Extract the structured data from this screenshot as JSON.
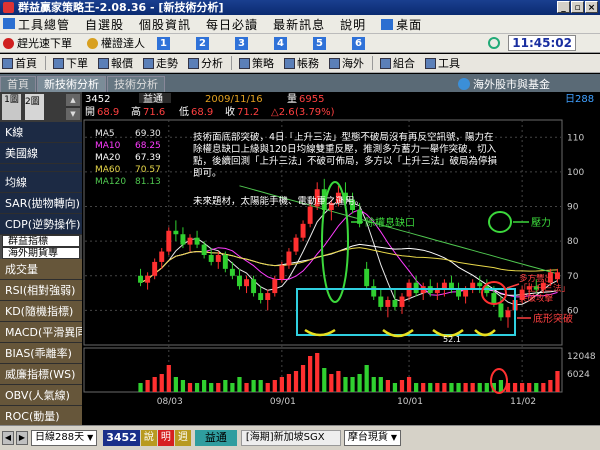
{
  "window": {
    "title": "群益贏家策略王-2.08.36 - [新技術分析]",
    "controls": [
      "_",
      "▫",
      "×"
    ]
  },
  "menu": [
    "工具總管",
    "自選股",
    "個股資訊",
    "每日必讀",
    "最新訊息",
    "說明",
    "桌面"
  ],
  "quickbar": {
    "items": [
      "趕光速下單",
      "權證達人"
    ],
    "numbers": [
      "1",
      "2",
      "3",
      "4",
      "5",
      "6"
    ],
    "clock": "11:45:02"
  },
  "toolbar": [
    "首頁",
    "下單",
    "報價",
    "走勢",
    "分析",
    "策略",
    "帳務",
    "海外",
    "組合",
    "工具"
  ],
  "tabs": [
    "首頁",
    "新技術分析",
    "技術分析"
  ],
  "overseas_label": "海外股市與基金",
  "left_panel": {
    "buttons": [
      "1圖",
      "2圖"
    ],
    "items": [
      "K線",
      "美國線",
      "",
      "均線",
      "SAR(拋物轉向)",
      "CDP(逆勢操作)",
      "群益指標",
      "海外期貨專",
      "成交量",
      "RSI(相對強弱)",
      "KD(隨機指標)",
      "MACD(平滑異同)",
      "BIAS(乖離率)",
      "威廉指標(WS)",
      "OBV(人氣線)",
      "ROC(動量)"
    ]
  },
  "stock_header": {
    "code": "3452",
    "name": "益通",
    "date": "2009/11/16",
    "volume_label": "量",
    "volume": "6955",
    "open_label": "開",
    "open": "68.9",
    "high_label": "高",
    "high": "71.6",
    "low_label": "低",
    "low": "68.9",
    "close_label": "收",
    "close": "71.2",
    "change": "△2.6",
    "change_pct": "(3.79%)",
    "period": "日288"
  },
  "ma_legend": [
    {
      "label": "MA5",
      "value": "69.30",
      "color": "#e8e8e8"
    },
    {
      "label": "MA10",
      "value": "68.25",
      "color": "#ff3cff"
    },
    {
      "label": "MA20",
      "value": "67.39",
      "color": "#ffffff"
    },
    {
      "label": "MA60",
      "value": "70.57",
      "color": "#e8d84a"
    },
    {
      "label": "MA120",
      "value": "81.13",
      "color": "#50c850"
    }
  ],
  "annotation": {
    "main_text": "技術面底部突破，4日「上升三法」型態不破局沒有再反空訊號，陽力在除權息缺口上緣與120日均線雙重反壓，推測多方蓄力一舉作突破，切入點，後續回測「上升三法」不破可佈局，多方以「上升三法」破局為停損即可。",
    "sub_text": "未來題材，太陽能手機、電動車之運用。",
    "label_gap": "除權息缺口",
    "label_pressure": "壓力",
    "label_rising": "多方豐出「上升三法」突破攻擊",
    "label_bottom": "底形突破"
  },
  "y_axis_price": [
    "110",
    "100",
    "90",
    "80",
    "70",
    "60"
  ],
  "y_axis_volume": [
    "12048",
    "6024"
  ],
  "x_axis": [
    "08/03",
    "09/01",
    "10/01",
    "11/02"
  ],
  "low_marker": "52.1",
  "bottom": {
    "range_label": "日線288天",
    "code": "3452",
    "buttons": [
      "說",
      "明",
      "週"
    ],
    "name": "益通",
    "ticker": "[海期]新加坡SGX",
    "market": "摩台現貨"
  },
  "chart_data": {
    "type": "candlestick",
    "x_ticks": [
      "08/03",
      "09/01",
      "10/01",
      "11/02"
    ],
    "price_ticks": [
      110,
      100,
      90,
      80,
      70,
      60
    ],
    "volume_ticks": [
      12048,
      6024
    ],
    "low_marker": 52.1,
    "candles": [
      {
        "o": 70,
        "h": 72,
        "l": 67,
        "c": 68
      },
      {
        "o": 68,
        "h": 71,
        "l": 66,
        "c": 70
      },
      {
        "o": 70,
        "h": 75,
        "l": 69,
        "c": 74
      },
      {
        "o": 74,
        "h": 78,
        "l": 72,
        "c": 77
      },
      {
        "o": 77,
        "h": 84,
        "l": 76,
        "c": 83
      },
      {
        "o": 83,
        "h": 86,
        "l": 80,
        "c": 82
      },
      {
        "o": 82,
        "h": 84,
        "l": 78,
        "c": 79
      },
      {
        "o": 79,
        "h": 82,
        "l": 77,
        "c": 81
      },
      {
        "o": 81,
        "h": 83,
        "l": 78,
        "c": 79
      },
      {
        "o": 79,
        "h": 80,
        "l": 75,
        "c": 76
      },
      {
        "o": 76,
        "h": 78,
        "l": 73,
        "c": 74
      },
      {
        "o": 74,
        "h": 77,
        "l": 72,
        "c": 76
      },
      {
        "o": 76,
        "h": 77,
        "l": 71,
        "c": 72
      },
      {
        "o": 72,
        "h": 74,
        "l": 69,
        "c": 70
      },
      {
        "o": 70,
        "h": 72,
        "l": 66,
        "c": 67
      },
      {
        "o": 67,
        "h": 70,
        "l": 65,
        "c": 69
      },
      {
        "o": 69,
        "h": 70,
        "l": 64,
        "c": 65
      },
      {
        "o": 65,
        "h": 67,
        "l": 62,
        "c": 63
      },
      {
        "o": 63,
        "h": 66,
        "l": 60,
        "c": 65
      },
      {
        "o": 65,
        "h": 70,
        "l": 64,
        "c": 69
      },
      {
        "o": 69,
        "h": 74,
        "l": 68,
        "c": 73
      },
      {
        "o": 73,
        "h": 78,
        "l": 72,
        "c": 77
      },
      {
        "o": 77,
        "h": 82,
        "l": 76,
        "c": 81
      },
      {
        "o": 81,
        "h": 86,
        "l": 80,
        "c": 85
      },
      {
        "o": 85,
        "h": 92,
        "l": 84,
        "c": 90
      },
      {
        "o": 90,
        "h": 97,
        "l": 89,
        "c": 95
      },
      {
        "o": 95,
        "h": 98,
        "l": 88,
        "c": 89
      },
      {
        "o": 89,
        "h": 92,
        "l": 86,
        "c": 91
      },
      {
        "o": 91,
        "h": 96,
        "l": 90,
        "c": 94
      },
      {
        "o": 94,
        "h": 97,
        "l": 91,
        "c": 92
      },
      {
        "o": 92,
        "h": 94,
        "l": 88,
        "c": 89
      },
      {
        "o": 89,
        "h": 91,
        "l": 84,
        "c": 85
      },
      {
        "o": 72,
        "h": 74,
        "l": 66,
        "c": 67
      },
      {
        "o": 67,
        "h": 69,
        "l": 63,
        "c": 64
      },
      {
        "o": 64,
        "h": 66,
        "l": 60,
        "c": 61
      },
      {
        "o": 61,
        "h": 64,
        "l": 58,
        "c": 63
      },
      {
        "o": 63,
        "h": 66,
        "l": 60,
        "c": 61
      },
      {
        "o": 61,
        "h": 65,
        "l": 59,
        "c": 64
      },
      {
        "o": 64,
        "h": 69,
        "l": 63,
        "c": 68
      },
      {
        "o": 68,
        "h": 70,
        "l": 64,
        "c": 65
      },
      {
        "o": 65,
        "h": 68,
        "l": 63,
        "c": 67
      },
      {
        "o": 67,
        "h": 69,
        "l": 64,
        "c": 65
      },
      {
        "o": 65,
        "h": 68,
        "l": 63,
        "c": 66
      },
      {
        "o": 66,
        "h": 69,
        "l": 64,
        "c": 68
      },
      {
        "o": 68,
        "h": 70,
        "l": 65,
        "c": 66
      },
      {
        "o": 66,
        "h": 68,
        "l": 63,
        "c": 64
      },
      {
        "o": 64,
        "h": 67,
        "l": 62,
        "c": 66
      },
      {
        "o": 66,
        "h": 69,
        "l": 65,
        "c": 68
      },
      {
        "o": 68,
        "h": 70,
        "l": 65,
        "c": 67
      },
      {
        "o": 67,
        "h": 69,
        "l": 64,
        "c": 65
      },
      {
        "o": 65,
        "h": 67,
        "l": 61,
        "c": 62
      },
      {
        "o": 62,
        "h": 64,
        "l": 57,
        "c": 58
      },
      {
        "o": 58,
        "h": 61,
        "l": 55,
        "c": 60
      },
      {
        "o": 60,
        "h": 64,
        "l": 59,
        "c": 63
      },
      {
        "o": 63,
        "h": 67,
        "l": 62,
        "c": 66
      },
      {
        "o": 66,
        "h": 68,
        "l": 64,
        "c": 67
      },
      {
        "o": 67,
        "h": 69,
        "l": 65,
        "c": 66
      },
      {
        "o": 66,
        "h": 69,
        "l": 65,
        "c": 68
      },
      {
        "o": 68,
        "h": 72,
        "l": 67,
        "c": 71
      },
      {
        "o": 69,
        "h": 72,
        "l": 68,
        "c": 71
      }
    ],
    "volumes": [
      3,
      4,
      5,
      6,
      9,
      5,
      4,
      3,
      3,
      4,
      3,
      3,
      4,
      3,
      5,
      3,
      4,
      4,
      3,
      4,
      5,
      6,
      7,
      9,
      12,
      13,
      8,
      6,
      7,
      5,
      5,
      6,
      9,
      5,
      5,
      4,
      3,
      4,
      5,
      3,
      3,
      3,
      3,
      3,
      3,
      3,
      3,
      3,
      3,
      3,
      3,
      4,
      3,
      3,
      3,
      3,
      3,
      3,
      4,
      7
    ],
    "volume_max": 14000
  }
}
